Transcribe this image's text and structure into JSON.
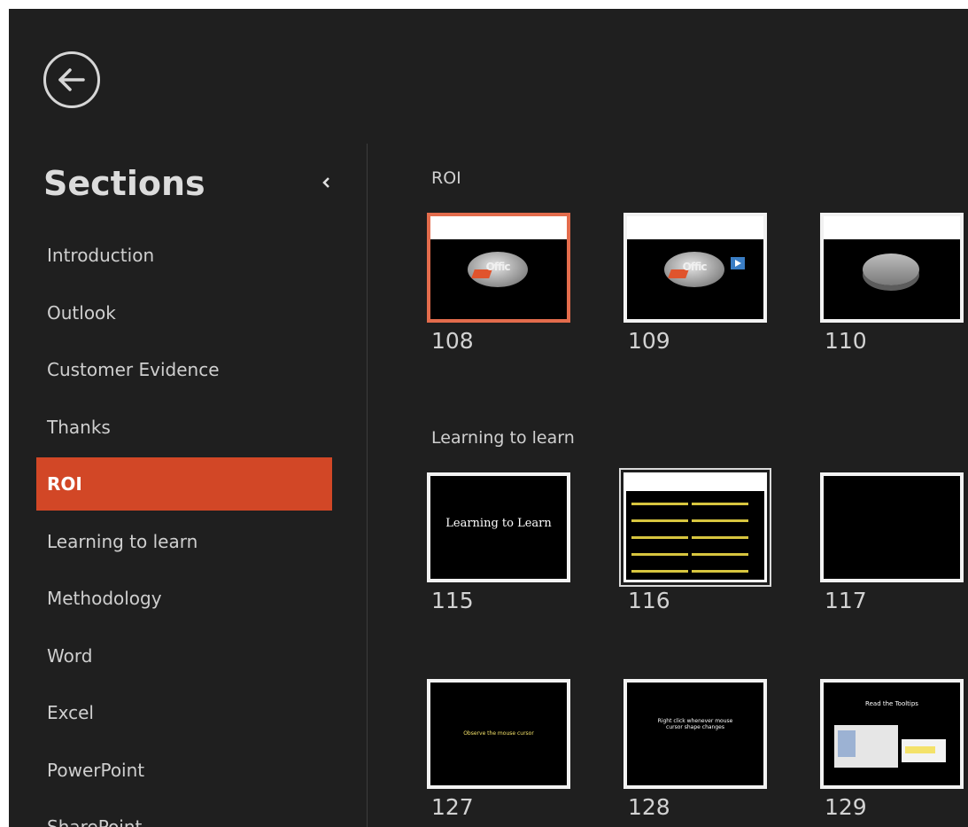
{
  "back": {
    "icon": "back-arrow-icon"
  },
  "sidebar": {
    "title": "Sections",
    "collapse_icon": "chevron-left-icon",
    "items": [
      {
        "label": "Introduction"
      },
      {
        "label": "Outlook"
      },
      {
        "label": "Customer Evidence"
      },
      {
        "label": "Thanks"
      },
      {
        "label": "ROI",
        "active": true
      },
      {
        "label": "Learning to learn"
      },
      {
        "label": "Methodology"
      },
      {
        "label": "Word"
      },
      {
        "label": "Excel"
      },
      {
        "label": "PowerPoint"
      },
      {
        "label": "SharePoint"
      }
    ]
  },
  "main": {
    "groups": [
      {
        "title": "ROI"
      },
      {
        "title": "Learning to learn"
      }
    ],
    "slides": [
      {
        "number": "108",
        "selected": true
      },
      {
        "number": "109"
      },
      {
        "number": "110"
      },
      {
        "number": "115",
        "text": "Learning to Learn"
      },
      {
        "number": "116"
      },
      {
        "number": "117"
      },
      {
        "number": "127",
        "text": "Observe the mouse cursor"
      },
      {
        "number": "128",
        "text": "Right click whenever mouse cursor shape changes"
      },
      {
        "number": "129",
        "text": "Read the Tooltips"
      }
    ]
  },
  "colors": {
    "background": "#1f1f1f",
    "accent": "#d24726",
    "selected_border": "#e36c4c"
  }
}
